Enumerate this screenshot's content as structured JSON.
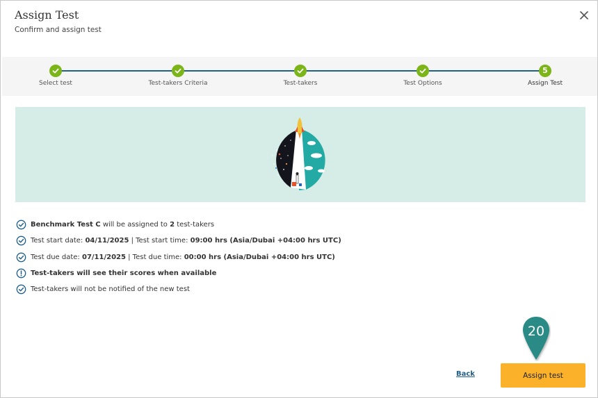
{
  "dialog": {
    "title": "Assign Test",
    "subtitle": "Confirm and assign test"
  },
  "stepper": {
    "steps": [
      {
        "label": "Select test",
        "status": "complete"
      },
      {
        "label": "Test-takers Criteria",
        "status": "complete"
      },
      {
        "label": "Test-takers",
        "status": "complete"
      },
      {
        "label": "Test Options",
        "status": "complete"
      },
      {
        "label": "Assign Test",
        "status": "current",
        "number": "5"
      }
    ]
  },
  "summary": {
    "line1": {
      "test_name": "Benchmark Test C",
      "text_a": " will be assigned to ",
      "count": "2",
      "text_b": " test-takers"
    },
    "line2": {
      "start_date_label": "Test start date: ",
      "start_date": "04/11/2025",
      "sep": " | Test start time: ",
      "start_time": "09:00 hrs (Asia/Dubai +04:00 hrs UTC)"
    },
    "line3": {
      "due_date_label": "Test due date: ",
      "due_date": "07/11/2025",
      "sep": " | Test due time: ",
      "due_time": "00:00 hrs (Asia/Dubai +04:00 hrs UTC)"
    },
    "line4": {
      "text": "Test-takers will see their scores when available"
    },
    "line5": {
      "text": "Test-takers will not be notified of the new test"
    }
  },
  "marker": {
    "number": "20"
  },
  "actions": {
    "back_label": "Back",
    "assign_label": "Assign test"
  },
  "colors": {
    "accent": "#1f5f8b",
    "step_complete": "#7cb518",
    "primary_button": "#fbb22a",
    "banner_bg": "#d6ece6",
    "marker": "#2a8a86"
  }
}
